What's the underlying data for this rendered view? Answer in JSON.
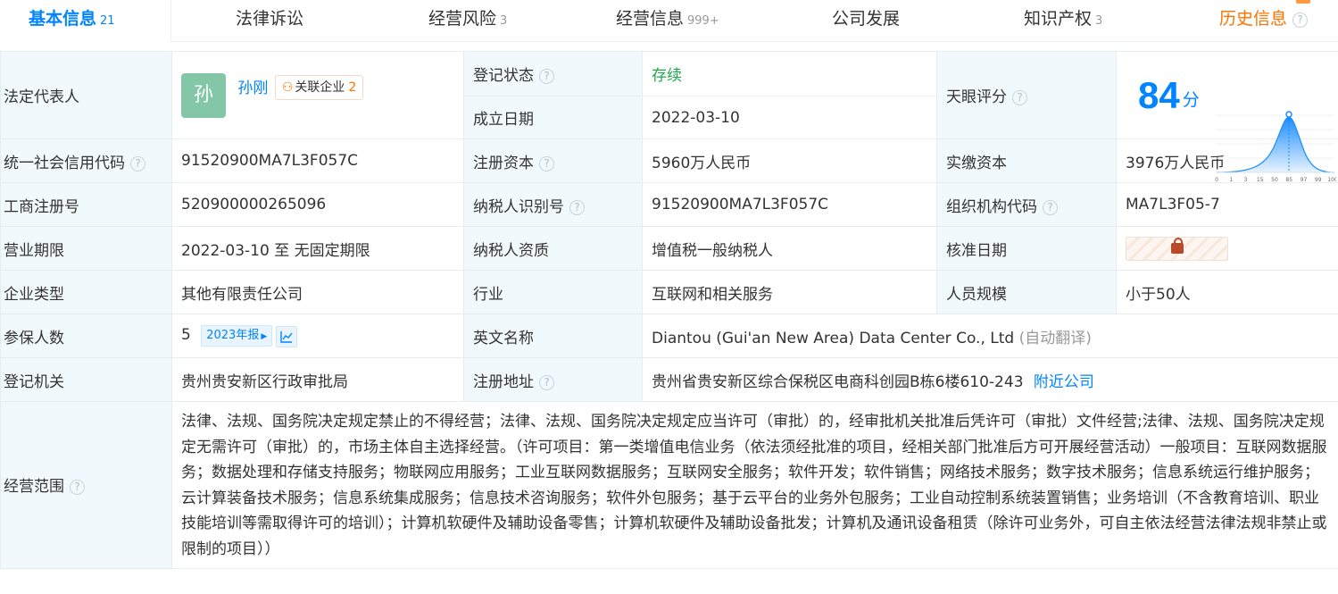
{
  "tabs": [
    {
      "label": "基本信息",
      "count": "21"
    },
    {
      "label": "法律诉讼",
      "count": ""
    },
    {
      "label": "经营风险",
      "count": "3"
    },
    {
      "label": "经营信息",
      "count": "999+"
    },
    {
      "label": "公司发展",
      "count": ""
    },
    {
      "label": "知识产权",
      "count": "3"
    },
    {
      "label": "历史信息",
      "count": ""
    }
  ],
  "legal_rep": {
    "label": "法定代表人",
    "avatar_char": "孙",
    "name": "孙刚",
    "related_label": "关联企业",
    "related_count": "2"
  },
  "reg_status": {
    "label": "登记状态",
    "value": "存续"
  },
  "found_date": {
    "label": "成立日期",
    "value": "2022-03-10"
  },
  "tianyan": {
    "label": "天眼评分",
    "score": "84",
    "unit": "分",
    "ticks": [
      "0",
      "1",
      "3",
      "15",
      "50",
      "85",
      "97",
      "99",
      "100"
    ]
  },
  "credit_code": {
    "label": "统一社会信用代码",
    "value": "91520900MA7L3F057C"
  },
  "reg_capital": {
    "label": "注册资本",
    "value": "5960万人民币"
  },
  "paid_capital": {
    "label": "实缴资本",
    "value": "3976万人民币"
  },
  "biz_reg_no": {
    "label": "工商注册号",
    "value": "520900000265096"
  },
  "taxpayer_id": {
    "label": "纳税人识别号",
    "value": "91520900MA7L3F057C"
  },
  "org_code": {
    "label": "组织机构代码",
    "value": "MA7L3F05-7"
  },
  "term": {
    "label": "营业期限",
    "value": "2022-03-10 至 无固定期限"
  },
  "taxpayer_qual": {
    "label": "纳税人资质",
    "value": "增值税一般纳税人"
  },
  "approve_date": {
    "label": "核准日期"
  },
  "company_type": {
    "label": "企业类型",
    "value": "其他有限责任公司"
  },
  "industry": {
    "label": "行业",
    "value": "互联网和相关服务"
  },
  "staff_size": {
    "label": "人员规模",
    "value": "小于50人"
  },
  "insured": {
    "label": "参保人数",
    "value": "5",
    "report": "2023年报"
  },
  "english_name": {
    "label": "英文名称",
    "value": "Diantou (Gui'an New Area) Data Center Co., Ltd",
    "note": "(自动翻译)"
  },
  "reg_authority": {
    "label": "登记机关",
    "value": "贵州贵安新区行政审批局"
  },
  "reg_address": {
    "label": "注册地址",
    "value": "贵州省贵安新区综合保税区电商科创园B栋6楼610-243",
    "nearby": "附近公司"
  },
  "scope": {
    "label": "经营范围",
    "value": "法律、法规、国务院决定规定禁止的不得经营；法律、法规、国务院决定规定应当许可（审批）的，经审批机关批准后凭许可（审批）文件经营;法律、法规、国务院决定规定无需许可（审批）的，市场主体自主选择经营。（许可项目：第一类增值电信业务（依法须经批准的项目，经相关部门批准后方可开展经营活动）一般项目：互联网数据服务；数据处理和存储支持服务；物联网应用服务；工业互联网数据服务；互联网安全服务；软件开发；软件销售；网络技术服务；数字技术服务；信息系统运行维护服务；云计算装备技术服务；信息系统集成服务；信息技术咨询服务；软件外包服务；基于云平台的业务外包服务；工业自动控制系统装置销售；业务培训（不含教育培训、职业技能培训等需取得许可的培训）；计算机软硬件及辅助设备零售；计算机软硬件及辅助设备批发；计算机及通讯设备租赁（除许可业务外，可自主依法经营法律法规非禁止或限制的项目））"
  }
}
